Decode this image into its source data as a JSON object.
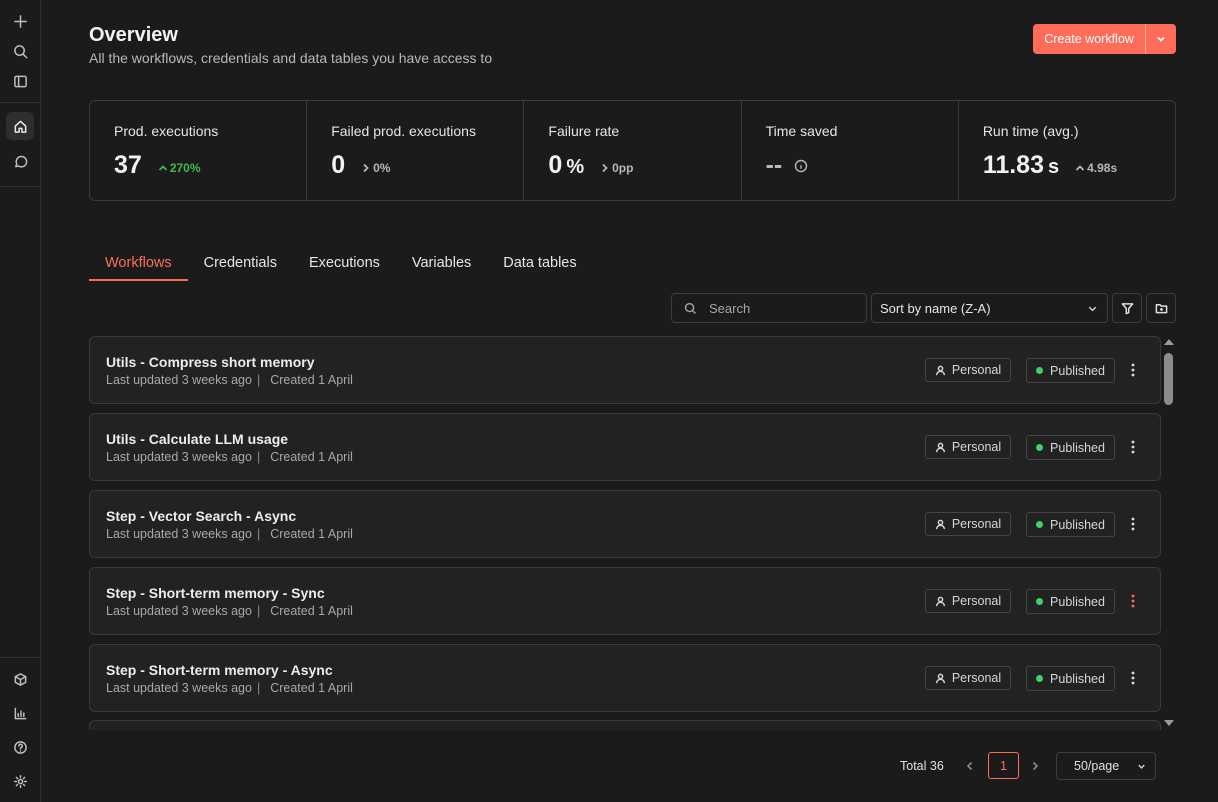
{
  "header": {
    "title": "Overview",
    "subtitle": "All the workflows, credentials and data tables you have access to",
    "create_label": "Create workflow"
  },
  "stats": [
    {
      "label": "Prod. executions",
      "value": "37",
      "unit": "",
      "delta": "270%",
      "delta_direction": "up",
      "delta_color": "#3fb950"
    },
    {
      "label": "Failed prod. executions",
      "value": "0",
      "unit": "",
      "delta": "0%",
      "delta_direction": "flat"
    },
    {
      "label": "Failure rate",
      "value": "0",
      "unit": "%",
      "delta": "0pp",
      "delta_direction": "flat"
    },
    {
      "label": "Time saved",
      "value": "--",
      "unit": "",
      "delta": "",
      "icon": "info-icon"
    },
    {
      "label": "Run time (avg.)",
      "value": "11.83",
      "unit": "s",
      "delta": "4.98s",
      "delta_direction": "up"
    }
  ],
  "tabs": [
    {
      "label": "Workflows",
      "active": true
    },
    {
      "label": "Credentials"
    },
    {
      "label": "Executions"
    },
    {
      "label": "Variables"
    },
    {
      "label": "Data tables"
    }
  ],
  "toolbar": {
    "search_placeholder": "Search",
    "sort_value": "Sort by name (Z-A)"
  },
  "workflows": [
    {
      "name": "Utils - Compress short memory",
      "updated": "Last updated 3 weeks ago",
      "divider": "|",
      "created": "Created 1 April",
      "owner": "Personal",
      "status": "Published"
    },
    {
      "name": "Utils - Calculate LLM usage",
      "updated": "Last updated 3 weeks ago",
      "divider": "|",
      "created": "Created 1 April",
      "owner": "Personal",
      "status": "Published"
    },
    {
      "name": "Step - Vector Search - Async",
      "updated": "Last updated 3 weeks ago",
      "divider": "|",
      "created": "Created 1 April",
      "owner": "Personal",
      "status": "Published"
    },
    {
      "name": "Step - Short-term memory - Sync",
      "updated": "Last updated 3 weeks ago",
      "divider": "|",
      "created": "Created 1 April",
      "owner": "Personal",
      "status": "Published"
    },
    {
      "name": "Step - Short-term memory - Async",
      "updated": "Last updated 3 weeks ago",
      "divider": "|",
      "created": "Created 1 April",
      "owner": "Personal",
      "status": "Published"
    }
  ],
  "pagination": {
    "total": "Total 36",
    "current_page": "1",
    "page_size": "50/page"
  },
  "colors": {
    "accent": "#ff6d5a",
    "published_dot": "#3fcf6b",
    "background": "#1b1b1b"
  }
}
